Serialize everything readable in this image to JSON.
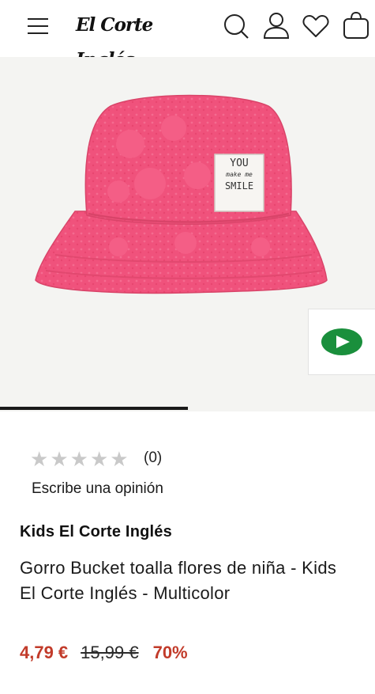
{
  "header": {
    "brand_logo": "El Corte Inglés",
    "icons": [
      "menu-icon",
      "search-icon",
      "user-icon",
      "heart-icon",
      "shopping-bag-icon"
    ]
  },
  "gallery": {
    "hat_label": {
      "line1": "YOU",
      "line2": "make me",
      "line3": "SMILE"
    },
    "image_progress": 0.5,
    "colors": {
      "hat": "#f0527c",
      "background": "#f4f4f2",
      "play_green": "#1a8f3c"
    }
  },
  "product": {
    "rating_count": "(0)",
    "stars": 0,
    "write_review": "Escribe una opinión",
    "brand": "Kids El Corte Inglés",
    "title": "Gorro Bucket toalla flores de niña - Kids El Corte Inglés - Multicolor",
    "price_current": "4,79 €",
    "price_original": "15,99 €",
    "discount": "70%",
    "price_color": "#c23b2a"
  }
}
